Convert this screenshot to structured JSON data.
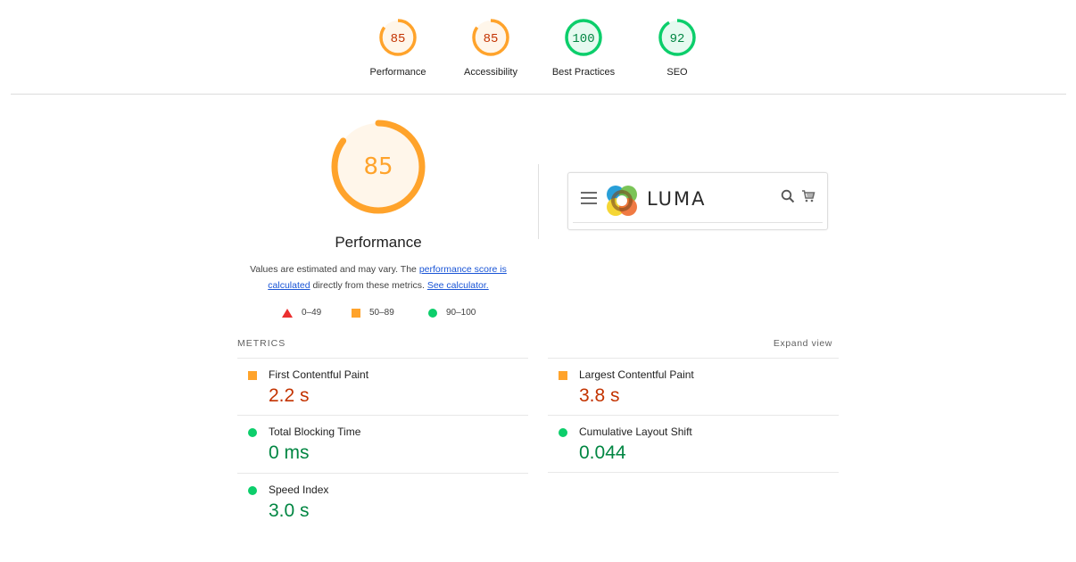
{
  "categories": [
    {
      "label": "Performance",
      "score": "85",
      "fraction": 0.85,
      "rating": "average"
    },
    {
      "label": "Accessibility",
      "score": "85",
      "fraction": 0.85,
      "rating": "average"
    },
    {
      "label": "Best Practices",
      "score": "100",
      "fraction": 1.0,
      "rating": "pass"
    },
    {
      "label": "SEO",
      "score": "92",
      "fraction": 0.92,
      "rating": "pass"
    }
  ],
  "performance": {
    "score": "85",
    "fraction": 0.85,
    "title": "Performance",
    "desc_prefix": "Values are estimated and may vary. The ",
    "link_score": "performance score is calculated",
    "desc_middle": " directly from these metrics. ",
    "link_calc": "See calculator."
  },
  "legend": [
    {
      "shape": "triangle",
      "range": "0–49",
      "color": "#eb2f2f"
    },
    {
      "shape": "square",
      "range": "50–89",
      "color": "#ffa32b"
    },
    {
      "shape": "circle",
      "range": "90–100",
      "color": "#0cce6b"
    }
  ],
  "screenshot": {
    "brand": "LUMA"
  },
  "metrics": {
    "section_label": "METRICS",
    "expand_label": "Expand view",
    "items": [
      {
        "name": "First Contentful Paint",
        "value": "2.2 s",
        "rating": "average"
      },
      {
        "name": "Largest Contentful Paint",
        "value": "3.8 s",
        "rating": "average"
      },
      {
        "name": "Total Blocking Time",
        "value": "0 ms",
        "rating": "pass"
      },
      {
        "name": "Cumulative Layout Shift",
        "value": "0.044",
        "rating": "pass"
      },
      {
        "name": "Speed Index",
        "value": "3.0 s",
        "rating": "pass"
      }
    ]
  },
  "colors": {
    "average_stroke": "#ffa32b",
    "average_fill": "#fff6ea",
    "average_text": "#c33300",
    "pass_stroke": "#0cce6b",
    "pass_fill": "#e6faf0",
    "pass_text": "#018642",
    "big_text": "#ffa32b"
  }
}
